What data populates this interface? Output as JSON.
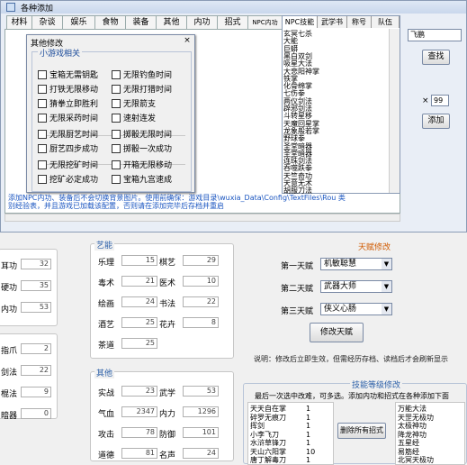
{
  "window": {
    "title": "各种添加"
  },
  "tabs": [
    "材料",
    "杂谈",
    "娱乐",
    "食物",
    "装备",
    "其他",
    "内功",
    "招式",
    "NPC内功",
    "NPC技能",
    "武学书",
    "称号",
    "队伍"
  ],
  "dialog": {
    "title": "其他修改",
    "close": "×",
    "group": "小游戏相关",
    "options": [
      {
        "label": "宝箱无需钥匙",
        "checked": false
      },
      {
        "label": "无限钓鱼时间",
        "checked": false
      },
      {
        "label": "打铁无限移动",
        "checked": false
      },
      {
        "label": "无限打猎时间",
        "checked": false
      },
      {
        "label": "猜拳立即胜利",
        "checked": false
      },
      {
        "label": "无限箭支",
        "checked": false
      },
      {
        "label": "无限采药时间",
        "checked": false
      },
      {
        "label": "速射连发",
        "checked": false
      },
      {
        "label": "无限厨艺时间",
        "checked": false
      },
      {
        "label": "掷骰无限时间",
        "checked": false
      },
      {
        "label": "厨艺四步成功",
        "checked": false
      },
      {
        "label": "掷骰一次成功",
        "checked": false
      },
      {
        "label": "无限挖矿时间",
        "checked": false
      },
      {
        "label": "开箱无限移动",
        "checked": false
      },
      {
        "label": "挖矿必定成功",
        "checked": false
      },
      {
        "label": "宝箱九宫速成",
        "checked": false
      }
    ]
  },
  "skill_list": {
    "headers": [
      "NPC技能",
      "武学书",
      "称号",
      "队伍"
    ],
    "items": [
      "玄冥七杀",
      "大能",
      "巨蟒",
      "黑白双剑",
      "吸星大法",
      "大悲阳神掌",
      "铁掌",
      "化骨绵掌",
      "七伤拳",
      "两仪剑法",
      "辟邪剑法",
      "斗转星移",
      "天魔回星掌",
      "龙象般若掌",
      "野球拳",
      "圣堂暗器",
      "圣堂暗器",
      "连珠剑法",
      "吞噬跌拳",
      "天竺奇功",
      "天意无术",
      "胡服刀法"
    ]
  },
  "right_panel": {
    "search_value": "飞鹏",
    "search_button": "查找",
    "qty_prefix": "×",
    "qty_value": "99",
    "add_button": "添加"
  },
  "hint": "添加NPC内功、装备后不会切换背景图片。使用前确保：游戏目录\\wuxia_Data\\Config\\TextFiles\\Rou 类别经验表，并且游戏已加载该配置，否则请在添加完毕后存档并重启",
  "left_stats_a": [
    {
      "label": "耳功",
      "value": "32"
    },
    {
      "label": "硬功",
      "value": "35"
    },
    {
      "label": "内功",
      "value": "53"
    }
  ],
  "left_stats_b": [
    {
      "label": "指爪",
      "value": "2"
    },
    {
      "label": "剑法",
      "value": "22"
    },
    {
      "label": "棍法",
      "value": "9"
    },
    {
      "label": "暗器",
      "value": "0"
    }
  ],
  "arts": {
    "title": "艺能",
    "items": [
      {
        "label": "乐理",
        "value": "15"
      },
      {
        "label": "棋艺",
        "value": "29"
      },
      {
        "label": "毒术",
        "value": "21"
      },
      {
        "label": "医术",
        "value": "10"
      },
      {
        "label": "绘画",
        "value": "24"
      },
      {
        "label": "书法",
        "value": "22"
      },
      {
        "label": "酒艺",
        "value": "25"
      },
      {
        "label": "花卉",
        "value": "8"
      },
      {
        "label": "茶道",
        "value": "25"
      }
    ]
  },
  "other": {
    "title": "其他",
    "items": [
      {
        "label": "实战",
        "value": "23"
      },
      {
        "label": "武学",
        "value": "53"
      },
      {
        "label": "气血",
        "value": "2347"
      },
      {
        "label": "内力",
        "value": "1296"
      },
      {
        "label": "攻击",
        "value": "78"
      },
      {
        "label": "防御",
        "value": "101"
      },
      {
        "label": "道德",
        "value": "81"
      },
      {
        "label": "名声",
        "value": "24"
      }
    ]
  },
  "talent": {
    "title": "天赋修改",
    "rows": [
      {
        "label": "第一天赋",
        "value": "机敏聪慧"
      },
      {
        "label": "第二天赋",
        "value": "武器大师"
      },
      {
        "label": "第三天赋",
        "value": "侠义心肠"
      }
    ],
    "modify_button": "修改天赋",
    "note": "说明：修改后立即生效，但需经历存档、读档后才会刷新显示"
  },
  "skill_level": {
    "title": "技能等级修改",
    "desc": "最后一次选中改难，可多选。添加内功和招式在各种添加下面",
    "items": [
      {
        "name": "天天自在掌",
        "level": "1"
      },
      {
        "name": "碎罗无痕刀",
        "level": "1"
      },
      {
        "name": "挥剑",
        "level": "1"
      },
      {
        "name": "小李飞刀",
        "level": "1"
      },
      {
        "name": "水浒草锋刀",
        "level": "1"
      },
      {
        "name": "天山六阳掌",
        "level": "10"
      },
      {
        "name": "唐丁解毒刀",
        "level": "1"
      }
    ],
    "delete_button": "删除所有招式",
    "right_items": [
      "万能大法",
      "天罡无极功",
      "太极神功",
      "降龙神功",
      "五星经",
      "易筋经",
      "北冥天极功"
    ]
  }
}
